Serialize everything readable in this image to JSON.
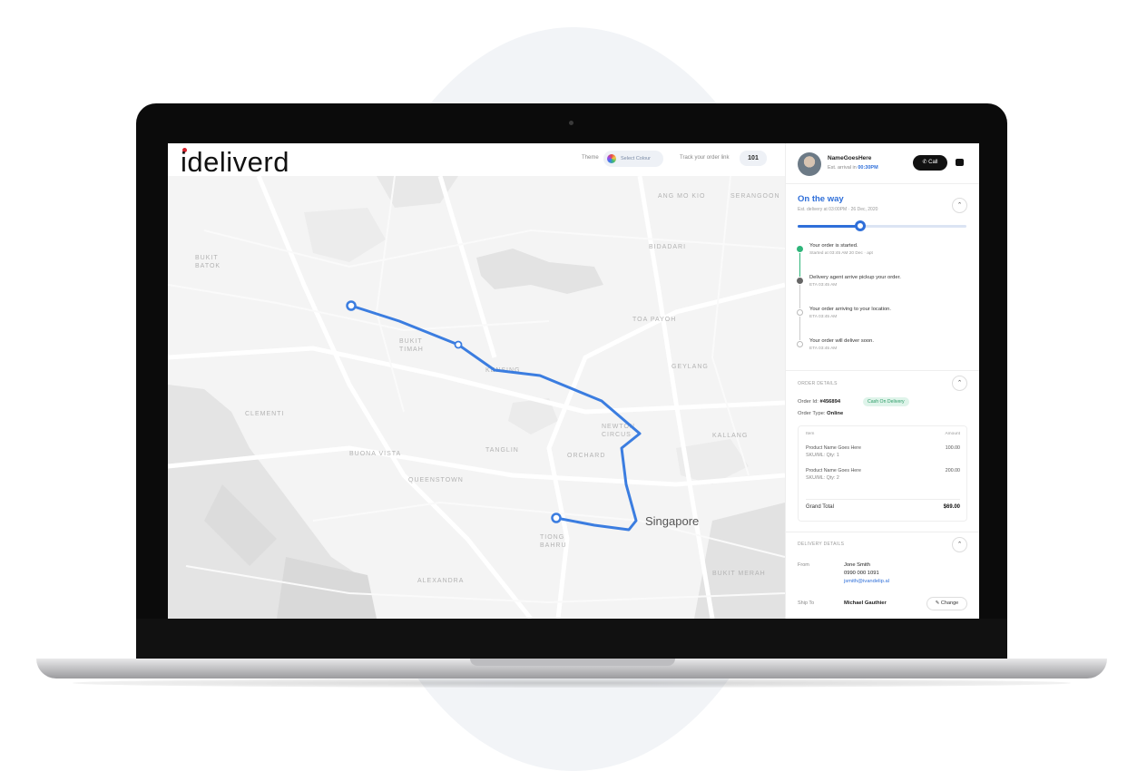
{
  "brand": {
    "logo_text": "ideliverd",
    "accent": "#2f6fd9",
    "logo_dot_color": "#d6202b"
  },
  "topbar": {
    "theme_label": "Theme",
    "theme_value": "Select Colour",
    "track_label": "Track your order link",
    "track_value": "101"
  },
  "map": {
    "city_label": "Singapore",
    "districts": [
      "BUKIT BATOK",
      "CLEMENTI",
      "BUKIT TIMAH",
      "QUEENSTOWN",
      "TANGLIN",
      "NEWTON CIRCUS",
      "ORCHARD",
      "GEYLANG",
      "TOA PAYOH",
      "KALLANG",
      "BUONA VISTA",
      "BUKIT MERAH",
      "ALEXANDRA",
      "TIONG BAHRU",
      "ANG MO KIO",
      "SERANGOON",
      "BIDADARI"
    ],
    "route_color": "#3b7de0"
  },
  "agent": {
    "name": "NameGoesHere",
    "eta_prefix": "Est. arrival in",
    "eta_value": "00:30PM",
    "call_label": "Call"
  },
  "status": {
    "title": "On the way",
    "subtitle": "Est. delivery at 03:00PM · 26 Dec, 2020",
    "progress": 0.37
  },
  "timeline": [
    {
      "title": "Your order is started.",
      "time": "Started at 03:45 AM 20 Dec · apt",
      "state": "done"
    },
    {
      "title": "Delivery agent arrive pickup your order.",
      "time": "ETA 03:45 AM",
      "state": "active"
    },
    {
      "title": "Your order arriving to your location.",
      "time": "ETA 03:45 AM",
      "state": "pending"
    },
    {
      "title": "Your order will deliver soon.",
      "time": "ETA 03:45 AM",
      "state": "pending"
    }
  ],
  "order_details": {
    "section_label": "Order Details",
    "order_id_label": "Order Id",
    "order_id_value": "#456894",
    "payment_badge": "Cash On Delivery",
    "order_type_label": "Order Type",
    "order_type_value": "Online",
    "items_header": {
      "item": "Item",
      "amount": "Amount"
    },
    "items": [
      {
        "name": "Product Name Goes Here",
        "meta": "SKU/ML: Qty: 1",
        "amount": "100.00"
      },
      {
        "name": "Product Name Goes Here",
        "meta": "SKU/ML: Qty: 2",
        "amount": "200.00"
      }
    ],
    "grand_total_label": "Grand Total",
    "grand_total_value": "$69.00"
  },
  "delivery_details": {
    "section_label": "Delivery Details",
    "from_label": "From",
    "from_name": "Jone Smith",
    "from_phone": "0990 000 1091",
    "from_email": "jsmith@ivandelip.al",
    "ship_to_label": "Ship To",
    "ship_to_name": "Michael Gauthier",
    "change_label": "Change"
  }
}
